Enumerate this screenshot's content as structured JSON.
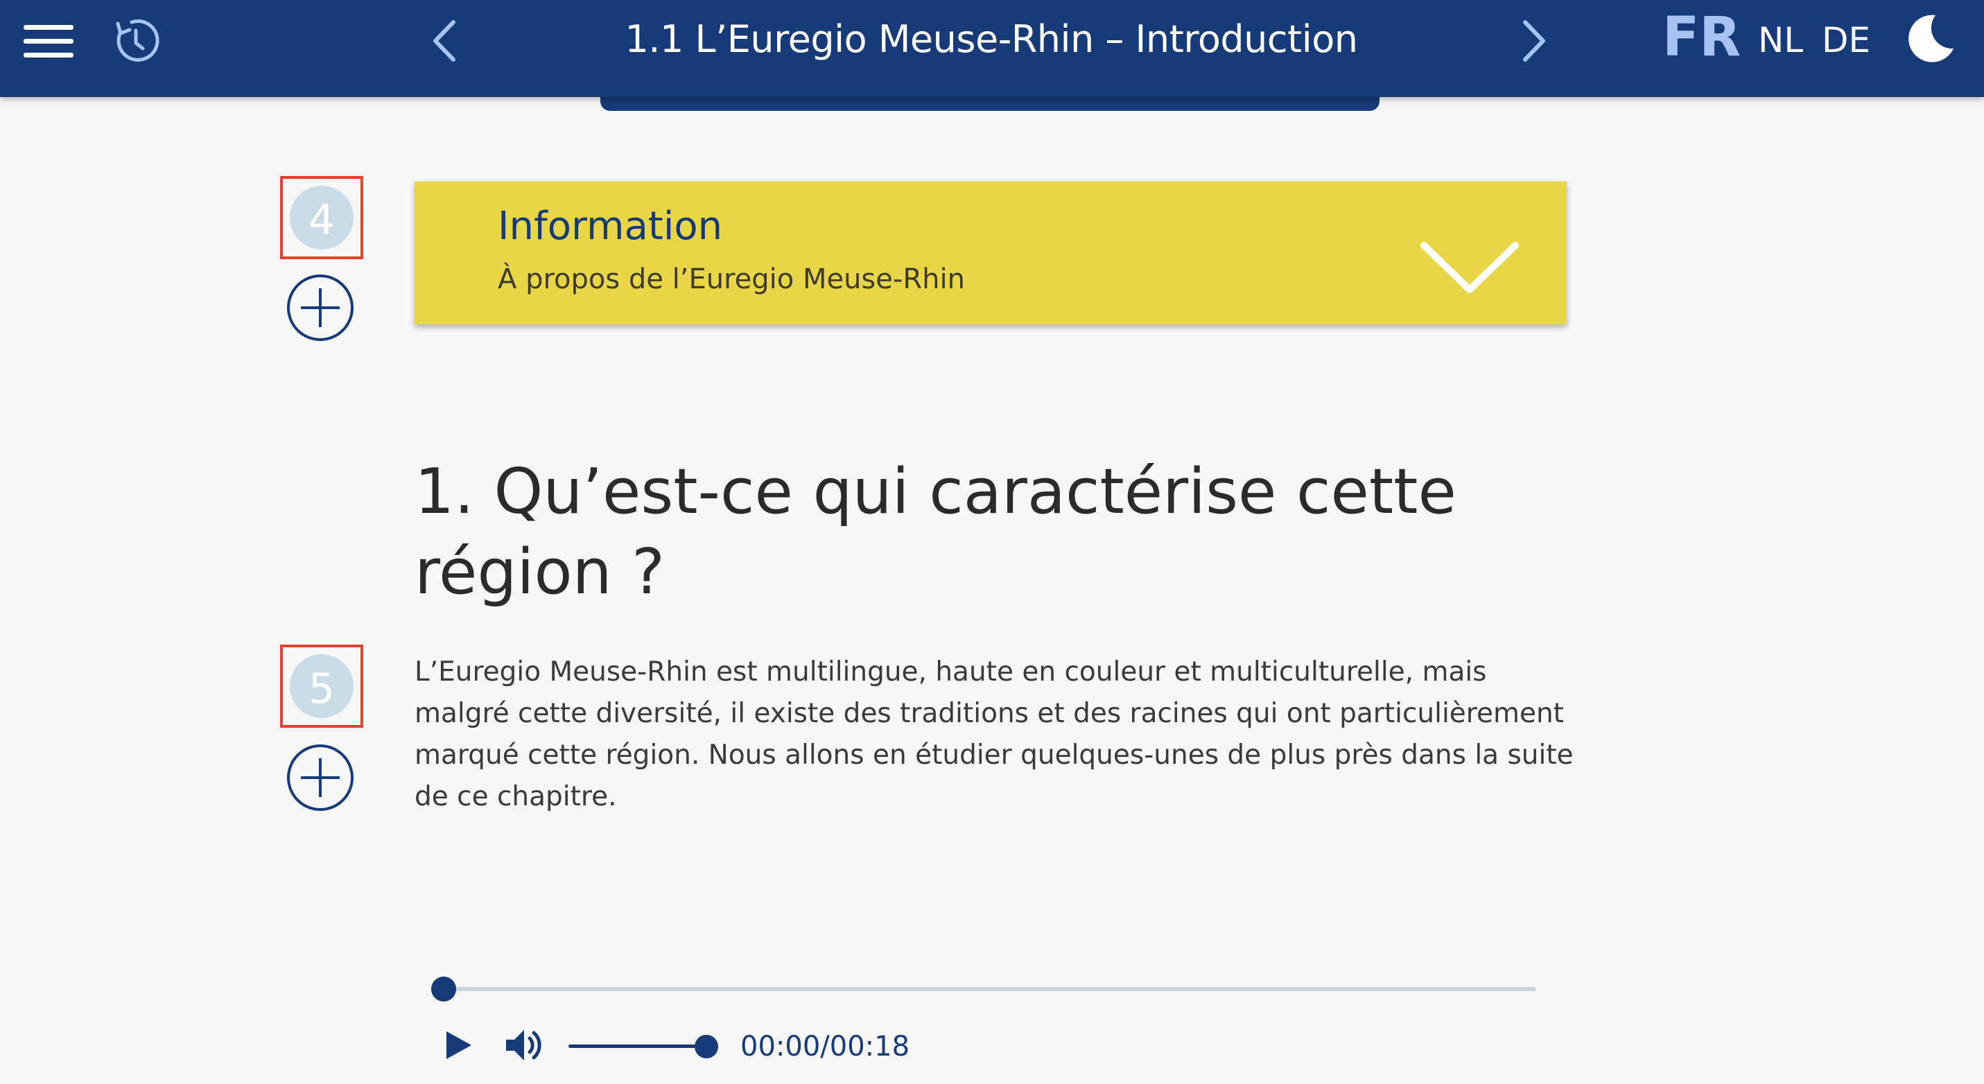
{
  "header": {
    "title": "1.1 L’Euregio Meuse-Rhin – Introduction",
    "languages": [
      {
        "code": "FR",
        "active": true
      },
      {
        "code": "NL",
        "active": false
      },
      {
        "code": "DE",
        "active": false
      }
    ],
    "icons": [
      "hamburger-menu-icon",
      "history-icon",
      "chevron-left-icon",
      "chevron-right-icon",
      "moon-icon"
    ],
    "background_color": "#173a78"
  },
  "markers": [
    {
      "number": "4"
    },
    {
      "number": "5"
    }
  ],
  "info_card": {
    "title": "Information",
    "subtitle": "À propos de l’Euregio Meuse-Rhin",
    "background_color": "#e8d647"
  },
  "section": {
    "heading": "1. Qu’est-ce qui caractérise cette région ?",
    "paragraph": "L’Euregio Meuse-Rhin est multilingue, haute en couleur et multiculturelle, mais malgré cette diversité, il existe des traditions et des racines qui ont particulièrement marqué cette région. Nous allons en étudier quelques-unes de plus près dans la suite de ce chapitre."
  },
  "audio_player": {
    "time": "00:00/00:18",
    "progress": 0,
    "volume": 1
  }
}
